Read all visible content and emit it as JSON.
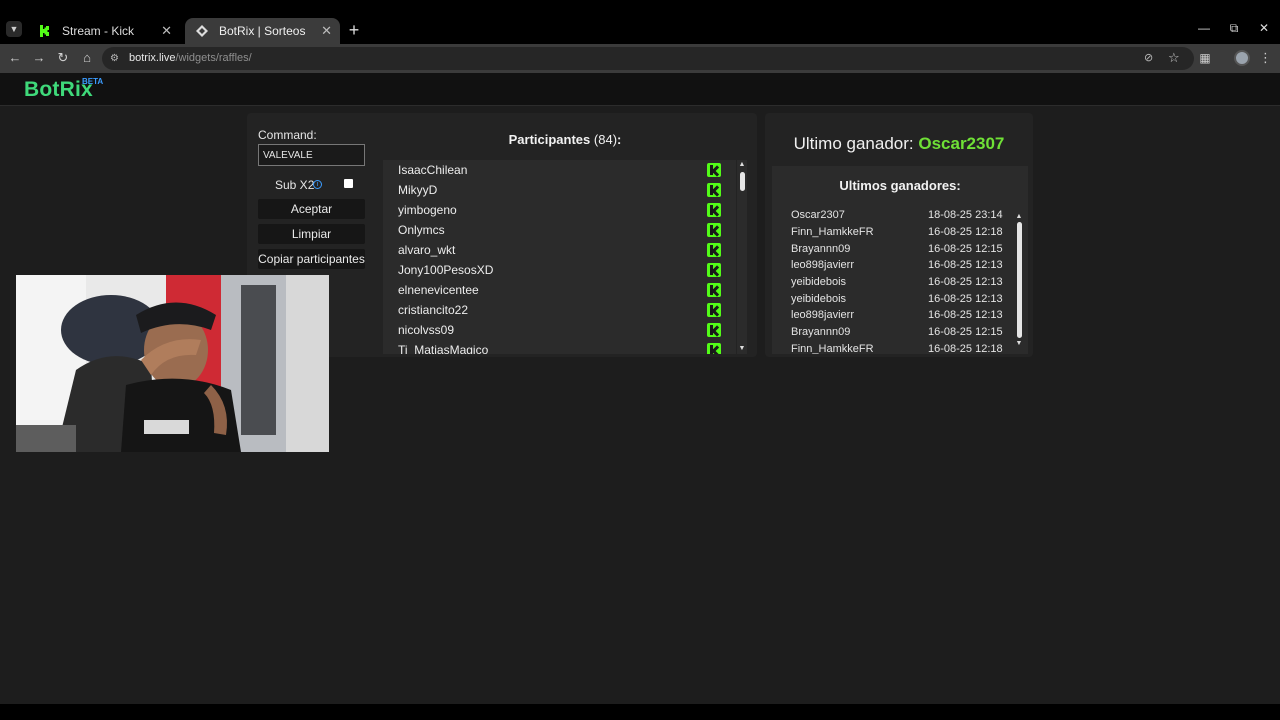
{
  "browser": {
    "tabs": [
      {
        "title": "Stream - Kick Dashboard"
      },
      {
        "title": "BotRix | Sorteos"
      }
    ],
    "url_host": "botrix.live",
    "url_path": "/widgets/raffles/"
  },
  "brand": {
    "name": "BotRix",
    "badge": "BETA"
  },
  "controls": {
    "command_label": "Command:",
    "command_value": "VALEVALE",
    "sub_x2_label": "Sub X2",
    "accept_label": "Aceptar",
    "clear_label": "Limpiar",
    "copy_label": "Copiar participantes"
  },
  "participants": {
    "title": "Participantes",
    "count": "(84)",
    "colon": ":",
    "items": [
      "IsaacChilean",
      "MikyyD",
      "yimbogeno",
      "Onlymcs",
      "alvaro_wkt",
      "Jony100PesosXD",
      "elnenevicentee",
      "cristiancito22",
      "nicolvss09",
      "Ti_MatiasMagico"
    ]
  },
  "winner": {
    "label": "Ultimo ganador:",
    "name": "Oscar2307"
  },
  "history": {
    "title": "Ultimos ganadores:",
    "rows": [
      {
        "name": "Oscar2307",
        "date": "18-08-25 23:14"
      },
      {
        "name": "Finn_HamkkeFR",
        "date": "16-08-25 12:18"
      },
      {
        "name": "Brayannn09",
        "date": "16-08-25 12:15"
      },
      {
        "name": "leo898javierr",
        "date": "16-08-25 12:13"
      },
      {
        "name": "yeibidebois",
        "date": "16-08-25 12:13"
      },
      {
        "name": "yeibidebois",
        "date": "16-08-25 12:13"
      },
      {
        "name": "leo898javierr",
        "date": "16-08-25 12:13"
      },
      {
        "name": "Brayannn09",
        "date": "16-08-25 12:15"
      },
      {
        "name": "Finn_HamkkeFR",
        "date": "16-08-25 12:18"
      }
    ]
  },
  "colors": {
    "brand_green": "#3fd97a",
    "kick_green": "#53fc18",
    "winner_green": "#6fe036",
    "beta_blue": "#3b9cff"
  }
}
